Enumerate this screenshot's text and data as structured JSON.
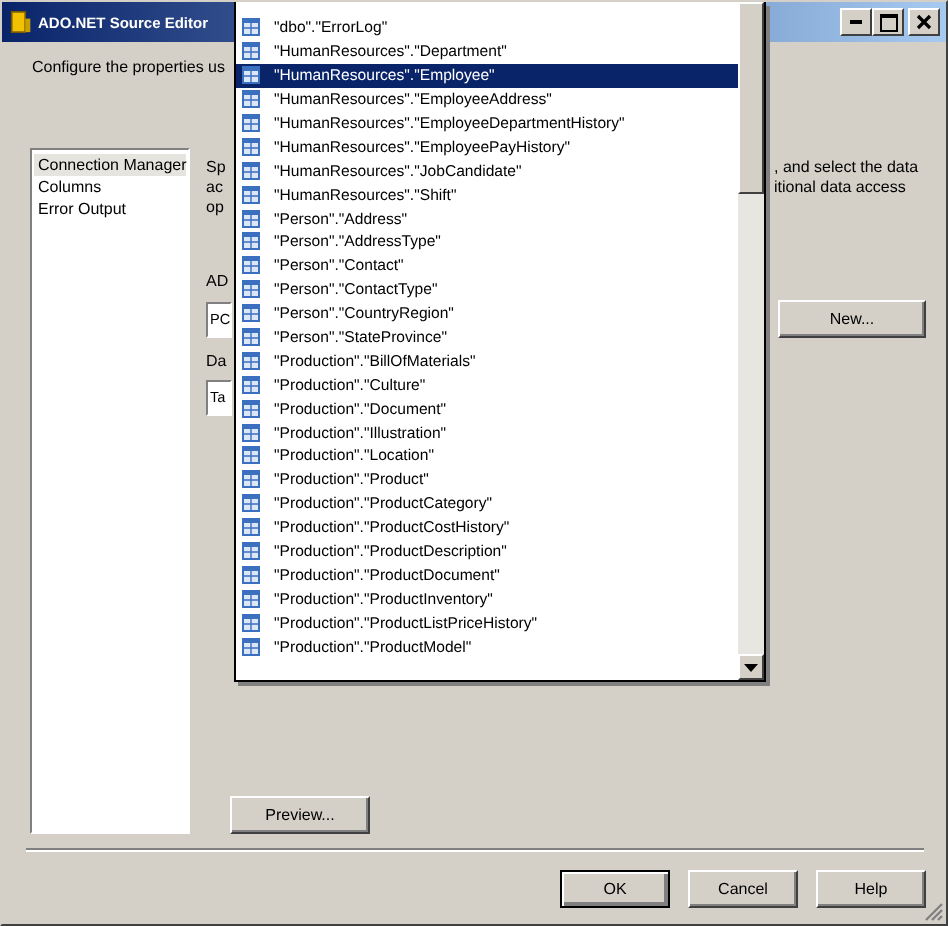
{
  "window": {
    "title": "ADO.NET Source Editor"
  },
  "description": "Configure the properties us",
  "pages": [
    {
      "label": "Connection Manager",
      "selected": true
    },
    {
      "label": "Columns",
      "selected": false
    },
    {
      "label": "Error Output",
      "selected": false
    }
  ],
  "instructions": {
    "left_lines": [
      "Sp",
      "ac",
      "op"
    ],
    "right_lines": [
      ", and select the data",
      "itional data access"
    ]
  },
  "connection_manager": {
    "label": "AD",
    "value": "PC",
    "button": "New..."
  },
  "data_access_mode": {
    "label": "Da",
    "value": "Ta"
  },
  "table_dropdown": {
    "items": [
      {
        "label": "\"dbo\".\"ErrorLog\"",
        "selected": false
      },
      {
        "label": "\"HumanResources\".\"Department\"",
        "selected": false
      },
      {
        "label": "\"HumanResources\".\"Employee\"",
        "selected": true
      },
      {
        "label": "\"HumanResources\".\"EmployeeAddress\"",
        "selected": false
      },
      {
        "label": "\"HumanResources\".\"EmployeeDepartmentHistory\"",
        "selected": false
      },
      {
        "label": "\"HumanResources\".\"EmployeePayHistory\"",
        "selected": false
      },
      {
        "label": "\"HumanResources\".\"JobCandidate\"",
        "selected": false
      },
      {
        "label": "\"HumanResources\".\"Shift\"",
        "selected": false
      },
      {
        "label": "\"Person\".\"Address\"",
        "selected": false
      },
      {
        "label": "\"Person\".\"AddressType\"",
        "selected": false
      },
      {
        "label": "\"Person\".\"Contact\"",
        "selected": false
      },
      {
        "label": "\"Person\".\"ContactType\"",
        "selected": false
      },
      {
        "label": "\"Person\".\"CountryRegion\"",
        "selected": false
      },
      {
        "label": "\"Person\".\"StateProvince\"",
        "selected": false
      },
      {
        "label": "\"Production\".\"BillOfMaterials\"",
        "selected": false
      },
      {
        "label": "\"Production\".\"Culture\"",
        "selected": false
      },
      {
        "label": "\"Production\".\"Document\"",
        "selected": false
      },
      {
        "label": "\"Production\".\"Illustration\"",
        "selected": false
      },
      {
        "label": "\"Production\".\"Location\"",
        "selected": false
      },
      {
        "label": "\"Production\".\"Product\"",
        "selected": false
      },
      {
        "label": "\"Production\".\"ProductCategory\"",
        "selected": false
      },
      {
        "label": "\"Production\".\"ProductCostHistory\"",
        "selected": false
      },
      {
        "label": "\"Production\".\"ProductDescription\"",
        "selected": false
      },
      {
        "label": "\"Production\".\"ProductDocument\"",
        "selected": false
      },
      {
        "label": "\"Production\".\"ProductInventory\"",
        "selected": false
      },
      {
        "label": "\"Production\".\"ProductListPriceHistory\"",
        "selected": false
      },
      {
        "label": "\"Production\".\"ProductModel\"",
        "selected": false
      }
    ]
  },
  "preview_button": "Preview...",
  "buttons": [
    "OK",
    "Cancel",
    "Help"
  ]
}
